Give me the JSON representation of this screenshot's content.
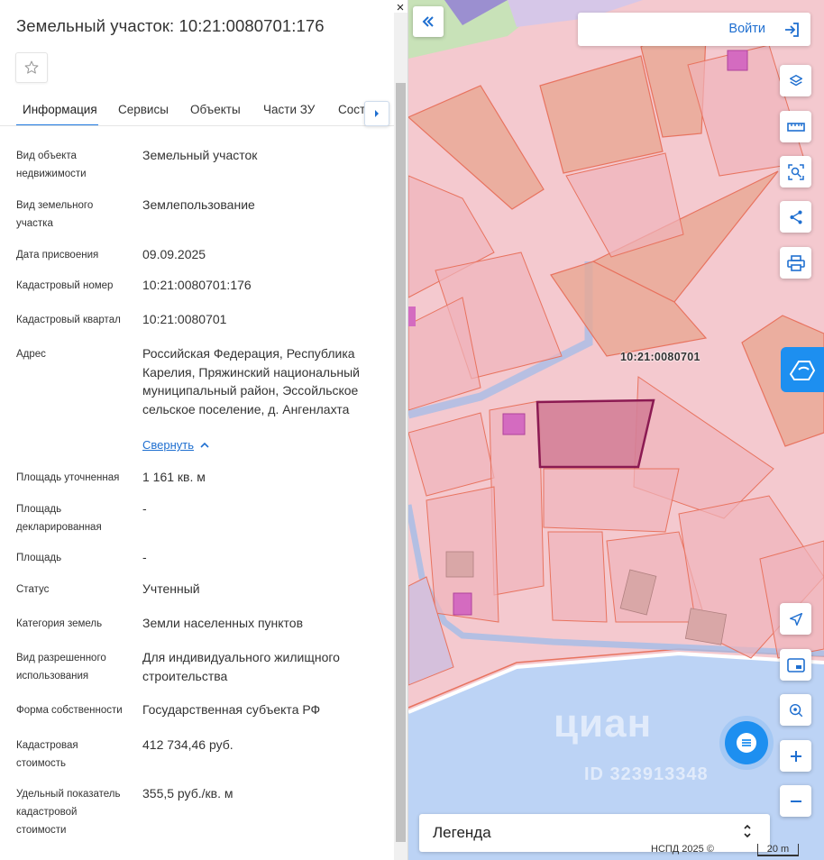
{
  "panel": {
    "title": "Земельный участок: 10:21:0080701:176",
    "close_icon": "×",
    "tabs": [
      {
        "label": "Информация"
      },
      {
        "label": "Сервисы"
      },
      {
        "label": "Объекты"
      },
      {
        "label": "Части ЗУ"
      },
      {
        "label": "Соста"
      }
    ],
    "rows": [
      {
        "label": "Вид объекта недвижимости",
        "value": "Земельный участок"
      },
      {
        "label": "Вид земельного участка",
        "value": "Землепользование"
      },
      {
        "label": "Дата присвоения",
        "value": "09.09.2025"
      },
      {
        "label": "Кадастровый номер",
        "value": "10:21:0080701:176"
      },
      {
        "label": "Кадастровый квартал",
        "value": "10:21:0080701"
      },
      {
        "label": "Адрес",
        "value": "Российская Федерация, Республика Карелия, Пряжинский национальный муниципальный район, Эссойльское сельское поселение, д. Ангенлахта"
      },
      {
        "label": "Площадь уточненная",
        "value": "1 161 кв. м"
      },
      {
        "label": "Площадь декларированная",
        "value": "-"
      },
      {
        "label": "Площадь",
        "value": "-"
      },
      {
        "label": "Статус",
        "value": "Учтенный"
      },
      {
        "label": "Категория земель",
        "value": "Земли населенных пунктов"
      },
      {
        "label": "Вид разрешенного использования",
        "value": "Для индивидуального жилищного строительства"
      },
      {
        "label": "Форма собственности",
        "value": "Государственная субъекта РФ"
      },
      {
        "label": "Кадастровая стоимость",
        "value": "412 734,46 руб."
      },
      {
        "label": "Удельный показатель кадастровой стоимости",
        "value": "355,5 руб./кв. м"
      }
    ],
    "collapse_link": "Свернуть"
  },
  "map": {
    "login_label": "Войти",
    "quarter_label": "10:21:0080701",
    "legend_label": "Легенда",
    "copyright": "НСПД 2025 ©",
    "scale_label": "20 m",
    "watermark": "циан",
    "watermark_id": "ID 323913348",
    "colors": {
      "land": "#f4c9cf",
      "water": "#bcd3f5",
      "selected_fill": "#d47f97",
      "selected_stroke": "#8b1a52",
      "parcel_stroke": "#e8735f",
      "accent": "#1d8ff0"
    }
  }
}
